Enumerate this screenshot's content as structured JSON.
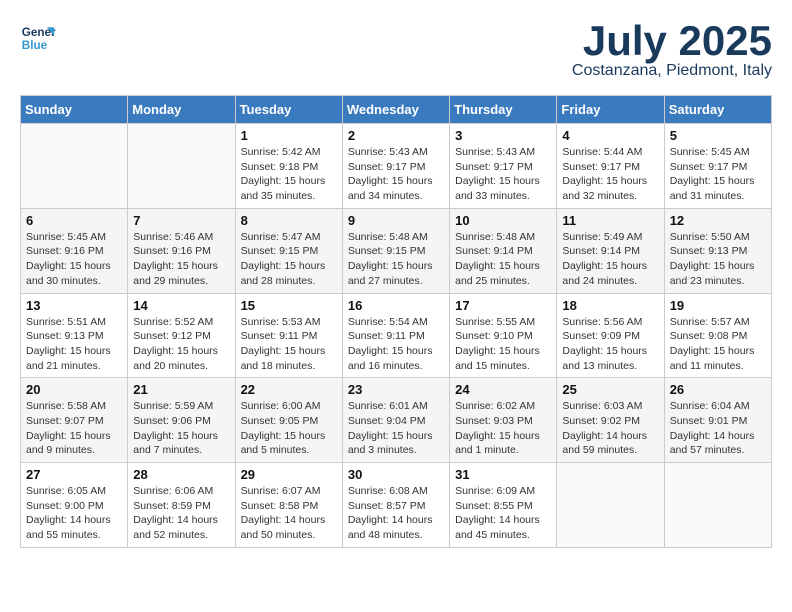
{
  "header": {
    "logo_general": "General",
    "logo_blue": "Blue",
    "month_title": "July 2025",
    "subtitle": "Costanzana, Piedmont, Italy"
  },
  "weekdays": [
    "Sunday",
    "Monday",
    "Tuesday",
    "Wednesday",
    "Thursday",
    "Friday",
    "Saturday"
  ],
  "weeks": [
    [
      {
        "day": "",
        "info": ""
      },
      {
        "day": "",
        "info": ""
      },
      {
        "day": "1",
        "info": "Sunrise: 5:42 AM\nSunset: 9:18 PM\nDaylight: 15 hours\nand 35 minutes."
      },
      {
        "day": "2",
        "info": "Sunrise: 5:43 AM\nSunset: 9:17 PM\nDaylight: 15 hours\nand 34 minutes."
      },
      {
        "day": "3",
        "info": "Sunrise: 5:43 AM\nSunset: 9:17 PM\nDaylight: 15 hours\nand 33 minutes."
      },
      {
        "day": "4",
        "info": "Sunrise: 5:44 AM\nSunset: 9:17 PM\nDaylight: 15 hours\nand 32 minutes."
      },
      {
        "day": "5",
        "info": "Sunrise: 5:45 AM\nSunset: 9:17 PM\nDaylight: 15 hours\nand 31 minutes."
      }
    ],
    [
      {
        "day": "6",
        "info": "Sunrise: 5:45 AM\nSunset: 9:16 PM\nDaylight: 15 hours\nand 30 minutes."
      },
      {
        "day": "7",
        "info": "Sunrise: 5:46 AM\nSunset: 9:16 PM\nDaylight: 15 hours\nand 29 minutes."
      },
      {
        "day": "8",
        "info": "Sunrise: 5:47 AM\nSunset: 9:15 PM\nDaylight: 15 hours\nand 28 minutes."
      },
      {
        "day": "9",
        "info": "Sunrise: 5:48 AM\nSunset: 9:15 PM\nDaylight: 15 hours\nand 27 minutes."
      },
      {
        "day": "10",
        "info": "Sunrise: 5:48 AM\nSunset: 9:14 PM\nDaylight: 15 hours\nand 25 minutes."
      },
      {
        "day": "11",
        "info": "Sunrise: 5:49 AM\nSunset: 9:14 PM\nDaylight: 15 hours\nand 24 minutes."
      },
      {
        "day": "12",
        "info": "Sunrise: 5:50 AM\nSunset: 9:13 PM\nDaylight: 15 hours\nand 23 minutes."
      }
    ],
    [
      {
        "day": "13",
        "info": "Sunrise: 5:51 AM\nSunset: 9:13 PM\nDaylight: 15 hours\nand 21 minutes."
      },
      {
        "day": "14",
        "info": "Sunrise: 5:52 AM\nSunset: 9:12 PM\nDaylight: 15 hours\nand 20 minutes."
      },
      {
        "day": "15",
        "info": "Sunrise: 5:53 AM\nSunset: 9:11 PM\nDaylight: 15 hours\nand 18 minutes."
      },
      {
        "day": "16",
        "info": "Sunrise: 5:54 AM\nSunset: 9:11 PM\nDaylight: 15 hours\nand 16 minutes."
      },
      {
        "day": "17",
        "info": "Sunrise: 5:55 AM\nSunset: 9:10 PM\nDaylight: 15 hours\nand 15 minutes."
      },
      {
        "day": "18",
        "info": "Sunrise: 5:56 AM\nSunset: 9:09 PM\nDaylight: 15 hours\nand 13 minutes."
      },
      {
        "day": "19",
        "info": "Sunrise: 5:57 AM\nSunset: 9:08 PM\nDaylight: 15 hours\nand 11 minutes."
      }
    ],
    [
      {
        "day": "20",
        "info": "Sunrise: 5:58 AM\nSunset: 9:07 PM\nDaylight: 15 hours\nand 9 minutes."
      },
      {
        "day": "21",
        "info": "Sunrise: 5:59 AM\nSunset: 9:06 PM\nDaylight: 15 hours\nand 7 minutes."
      },
      {
        "day": "22",
        "info": "Sunrise: 6:00 AM\nSunset: 9:05 PM\nDaylight: 15 hours\nand 5 minutes."
      },
      {
        "day": "23",
        "info": "Sunrise: 6:01 AM\nSunset: 9:04 PM\nDaylight: 15 hours\nand 3 minutes."
      },
      {
        "day": "24",
        "info": "Sunrise: 6:02 AM\nSunset: 9:03 PM\nDaylight: 15 hours\nand 1 minute."
      },
      {
        "day": "25",
        "info": "Sunrise: 6:03 AM\nSunset: 9:02 PM\nDaylight: 14 hours\nand 59 minutes."
      },
      {
        "day": "26",
        "info": "Sunrise: 6:04 AM\nSunset: 9:01 PM\nDaylight: 14 hours\nand 57 minutes."
      }
    ],
    [
      {
        "day": "27",
        "info": "Sunrise: 6:05 AM\nSunset: 9:00 PM\nDaylight: 14 hours\nand 55 minutes."
      },
      {
        "day": "28",
        "info": "Sunrise: 6:06 AM\nSunset: 8:59 PM\nDaylight: 14 hours\nand 52 minutes."
      },
      {
        "day": "29",
        "info": "Sunrise: 6:07 AM\nSunset: 8:58 PM\nDaylight: 14 hours\nand 50 minutes."
      },
      {
        "day": "30",
        "info": "Sunrise: 6:08 AM\nSunset: 8:57 PM\nDaylight: 14 hours\nand 48 minutes."
      },
      {
        "day": "31",
        "info": "Sunrise: 6:09 AM\nSunset: 8:55 PM\nDaylight: 14 hours\nand 45 minutes."
      },
      {
        "day": "",
        "info": ""
      },
      {
        "day": "",
        "info": ""
      }
    ]
  ]
}
